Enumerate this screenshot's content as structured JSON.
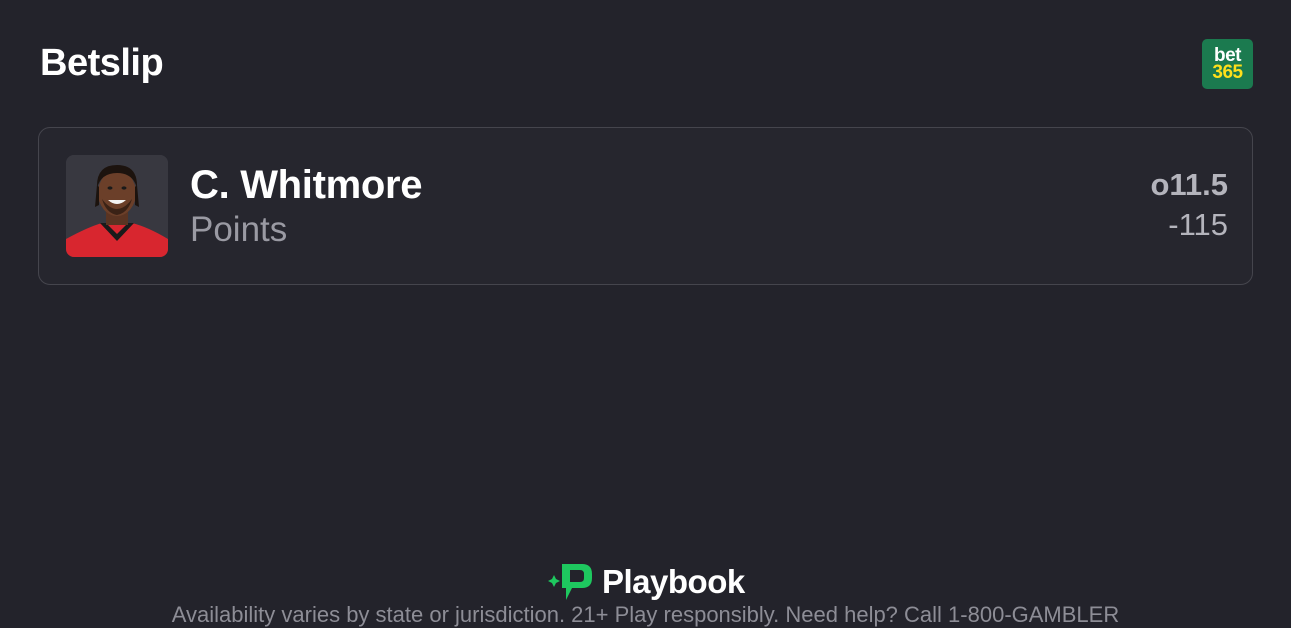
{
  "header": {
    "title": "Betslip"
  },
  "sportsbook": {
    "logo_line1": "bet",
    "logo_line2": "365",
    "brand_color": "#1b7a4f",
    "accent_color": "#ffdf1b"
  },
  "bet": {
    "player_name": "C. Whitmore",
    "market": "Points",
    "line": "o11.5",
    "odds": "-115"
  },
  "footer": {
    "brand_name": "Playbook",
    "brand_icon": "playbook-logo-icon",
    "brand_icon_color": "#1ec85f",
    "disclaimer": "Availability varies by state or jurisdiction. 21+ Play responsibly. Need help? Call 1-800-GAMBLER"
  }
}
